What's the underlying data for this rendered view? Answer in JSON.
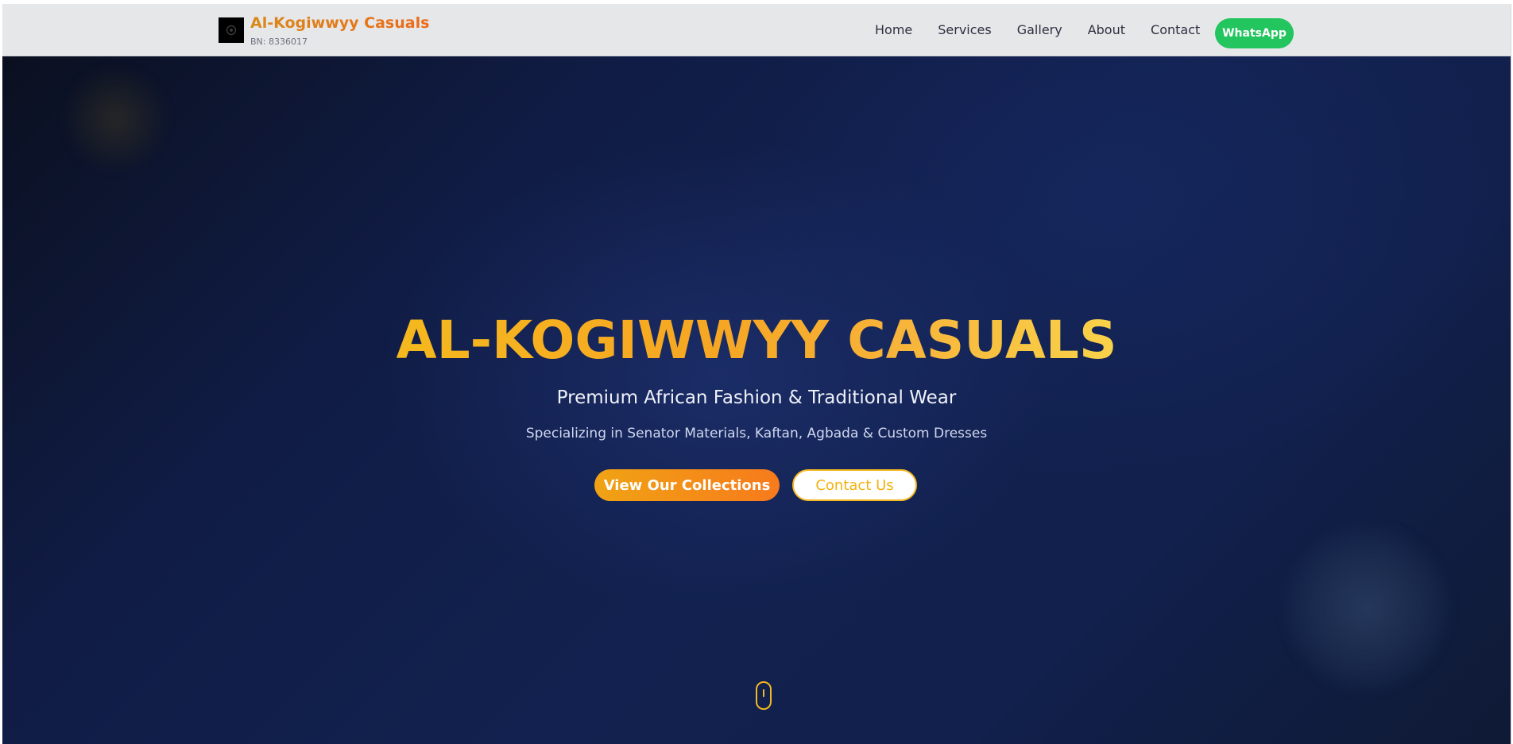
{
  "navbar": {
    "brand_name": "Al-Kogiwwyy Casuals",
    "brand_bn": "BN: 8336017",
    "logo_icon": "logo-icon",
    "links": [
      {
        "label": "Home"
      },
      {
        "label": "Services"
      },
      {
        "label": "Gallery"
      },
      {
        "label": "About"
      },
      {
        "label": "Contact"
      }
    ],
    "whatsapp_label": "WhatsApp"
  },
  "hero": {
    "title": "AL-KOGIWWYY CASUALS",
    "subtitle": "Premium African Fashion & Traditional Wear",
    "description": "Specializing in Senator Materials, Kaftan, Agbada & Custom Dresses",
    "primary_button": "View Our Collections",
    "secondary_button": "Contact Us",
    "scroll_icon": "mouse-scroll-icon"
  },
  "colors": {
    "brand_gradient_start": "#f0a314",
    "brand_gradient_end": "#f77a1c",
    "gold": "#f5b820",
    "whatsapp_green": "#22c55e",
    "navbar_bg": "#e6e7e9",
    "hero_bg": "#12214f"
  }
}
